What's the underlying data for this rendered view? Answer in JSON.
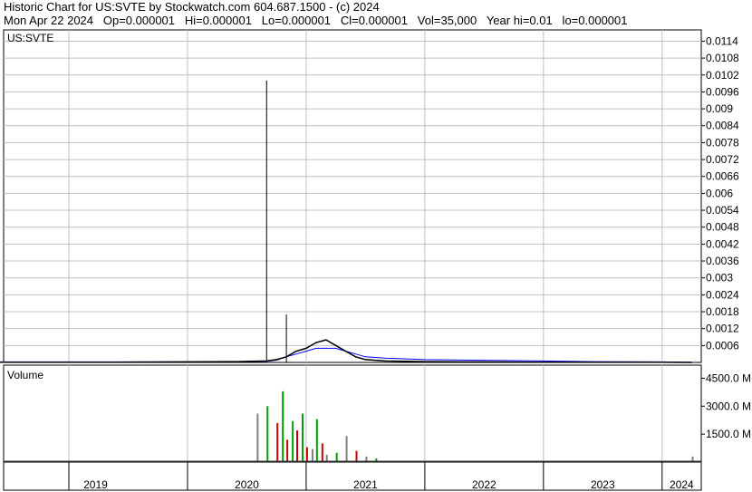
{
  "header": {
    "title_line": "Historic Chart for US:SVTE by Stockwatch.com 604.687.1500 - (c) 2024",
    "info_line": "Mon Apr 22 2024   Op=0.000001   Hi=0.000001   Lo=0.000001   Cl=0.000001   Vol=35,000   Year hi=0.01   lo=0.000001"
  },
  "chart_data": [
    {
      "type": "line",
      "title": "US:SVTE",
      "y_ticks": [
        "0.0114",
        "0.0108",
        "0.0102",
        "0.0096",
        "0.009",
        "0.0084",
        "0.0078",
        "0.0072",
        "0.0066",
        "0.006",
        "0.0054",
        "0.0048",
        "0.0042",
        "0.0036",
        "0.003",
        "0.0024",
        "0.0018",
        "0.0012",
        "0.0006"
      ],
      "ylim": [
        0,
        0.0118
      ],
      "x_labels": [
        "2019",
        "2020",
        "2021",
        "2022",
        "2023",
        "2024"
      ],
      "x": [
        "2018-06",
        "2019-01",
        "2019-06",
        "2020-01",
        "2020-06",
        "2020-09",
        "2020-10",
        "2020-11",
        "2020-12",
        "2021-01",
        "2021-02",
        "2021-03",
        "2021-04",
        "2021-05",
        "2021-06",
        "2021-07",
        "2021-09",
        "2022-01",
        "2022-06",
        "2023-01",
        "2023-06",
        "2024-01",
        "2024-04"
      ],
      "series": [
        {
          "values": [
            1e-05,
            1e-05,
            1e-05,
            2e-05,
            3e-05,
            5e-05,
            0.0001,
            0.0002,
            0.0004,
            0.0005,
            0.0007,
            0.0008,
            0.0006,
            0.0004,
            0.0002,
            0.0001,
            5e-05,
            3e-05,
            2e-05,
            1e-05,
            1e-05,
            5e-06,
            1e-06
          ]
        },
        {
          "values": [
            2e-05,
            2e-05,
            2e-05,
            2e-05,
            3e-05,
            4e-05,
            8e-05,
            0.0002,
            0.0003,
            0.0004,
            0.0005,
            0.0005,
            0.0005,
            0.0004,
            0.0003,
            0.0002,
            0.00015,
            0.0001,
            8e-05,
            5e-05,
            3e-05,
            2e-05,
            1e-05
          ]
        }
      ],
      "spikes": [
        {
          "x": "2020-09",
          "high": 0.01
        },
        {
          "x": "2020-11",
          "high": 0.0017
        }
      ],
      "colors": {
        "price": "#000000",
        "ma_short": "#ff00ff",
        "ma_long": "#0000ff",
        "grid": "#c0c0c0"
      }
    },
    {
      "type": "bar",
      "title": "Volume",
      "y_ticks": [
        "4500.0 M",
        "3000.0 M",
        "1500.0 M"
      ],
      "ylim": [
        0,
        5200
      ],
      "x": [
        "2020-08",
        "2020-09",
        "2020-10",
        "2020-10",
        "2020-11",
        "2020-11",
        "2020-12",
        "2020-12",
        "2021-01",
        "2021-01",
        "2021-02",
        "2021-02",
        "2021-03",
        "2021-04",
        "2021-05",
        "2021-06",
        "2021-07",
        "2021-08",
        "2024-04"
      ],
      "values": [
        2600,
        3000,
        2100,
        3800,
        1200,
        2200,
        1700,
        2600,
        800,
        700,
        2300,
        1000,
        400,
        500,
        1400,
        600,
        300,
        200,
        300
      ],
      "bar_colors": [
        "#808080",
        "#00a000",
        "#d00000",
        "#00a000",
        "#d00000",
        "#00a000",
        "#d00000",
        "#00a000",
        "#d00000",
        "#808080",
        "#00a000",
        "#d00000",
        "#808080",
        "#00a000",
        "#808080",
        "#d00000",
        "#808080",
        "#00a000",
        "#808080"
      ]
    }
  ]
}
